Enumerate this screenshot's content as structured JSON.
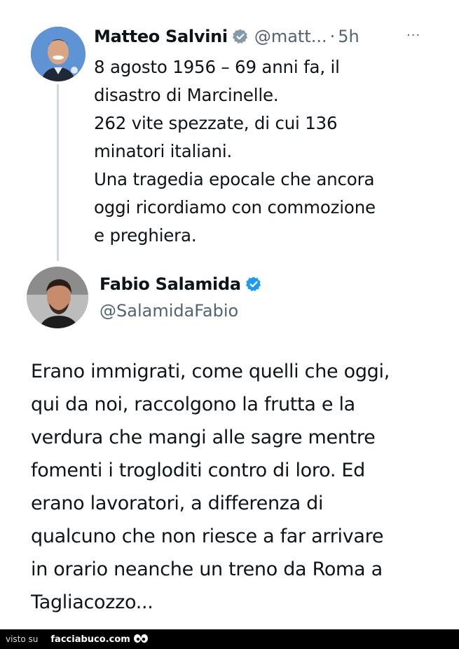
{
  "tweet_original": {
    "author_name": "Matteo Salvini",
    "handle": "@matt...",
    "separator": "·",
    "time": "5h",
    "more_label": "···",
    "text": "8 agosto 1956 – 69 anni fa, il\ndisastro di Marcinelle.\n262 vite spezzate, di cui 136\nminatori italiani.\nUna tragedia epocale che ancora\noggi ricordiamo con commozione\ne preghiera."
  },
  "tweet_reply": {
    "author_name": "Fabio Salamida",
    "handle": "@SalamidaFabio",
    "text": "Erano immigrati, come quelli che oggi,\nqui da noi, raccolgono la frutta e la\nverdura che mangi alle sagre mentre\nfomenti i trogloditi contro di loro. Ed\nerano lavoratori, a differenza di\nqualcuno che non riesce a far arrivare\nin orario neanche un treno da Roma a\nTagliacozzo..."
  },
  "footer": {
    "visto_label": "visto su",
    "site_label": "facciabuco.com"
  },
  "colors": {
    "verified_gray": "#829aab",
    "verified_blue": "#1d9bf0",
    "text": "#0f1419",
    "secondary": "#536471",
    "thread_line": "#cfd9de"
  },
  "icons": {
    "gray_badge": "verified-gray-badge-icon",
    "blue_badge": "verified-blue-badge-icon",
    "more": "more-options-icon",
    "eyes": "eyes-logo-icon"
  }
}
